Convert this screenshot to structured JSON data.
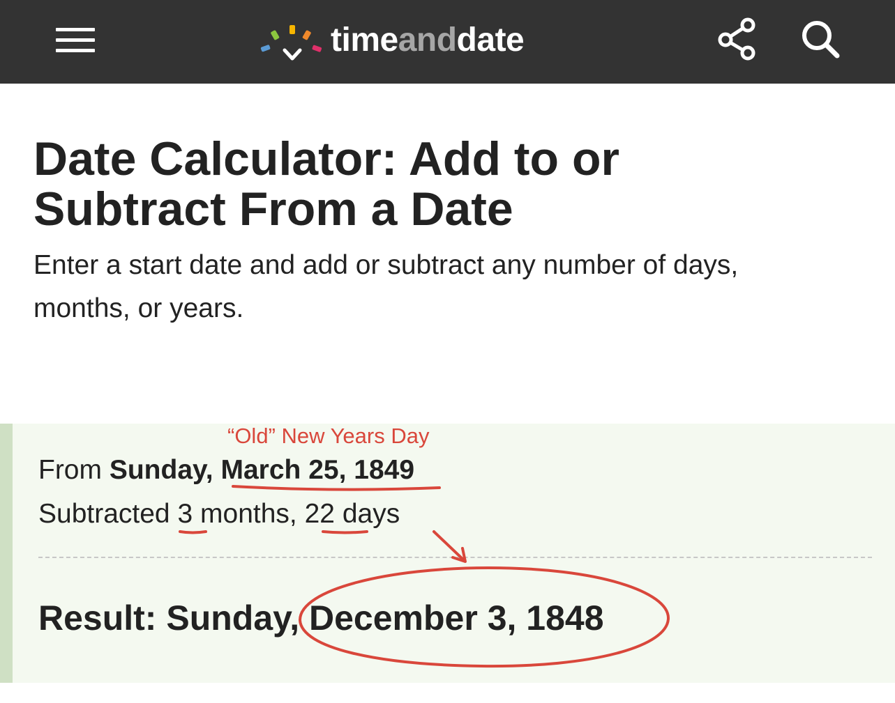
{
  "header": {
    "brand_part1": "time",
    "brand_part2": "and",
    "brand_part3": "date",
    "menu_icon": "hamburger-menu-icon",
    "share_icon": "share-icon",
    "search_icon": "search-icon",
    "logo_colors": [
      "#5b9bd5",
      "#8cc63f",
      "#f7b500",
      "#f0892b",
      "#e0306a"
    ],
    "background_color": "#333333"
  },
  "page": {
    "title_line1": "Date Calculator: Add to or",
    "title_line2": "Subtract From a Date",
    "subtitle_line1": "Enter a start date and add or subtract any number of days,",
    "subtitle_line2": "months, or years."
  },
  "result": {
    "from_prefix": "From",
    "from_weekday": "Sunday,",
    "from_date": "March 25, 1849",
    "sub_prefix": "Subtracted",
    "months_value": "3",
    "months_unit": "months,",
    "days_value": "22",
    "days_unit": "days",
    "result_label": "Result: Sunday, December 3, 1848"
  },
  "annotation": {
    "label": "“Old” New Years Day",
    "color": "#d9473b"
  }
}
